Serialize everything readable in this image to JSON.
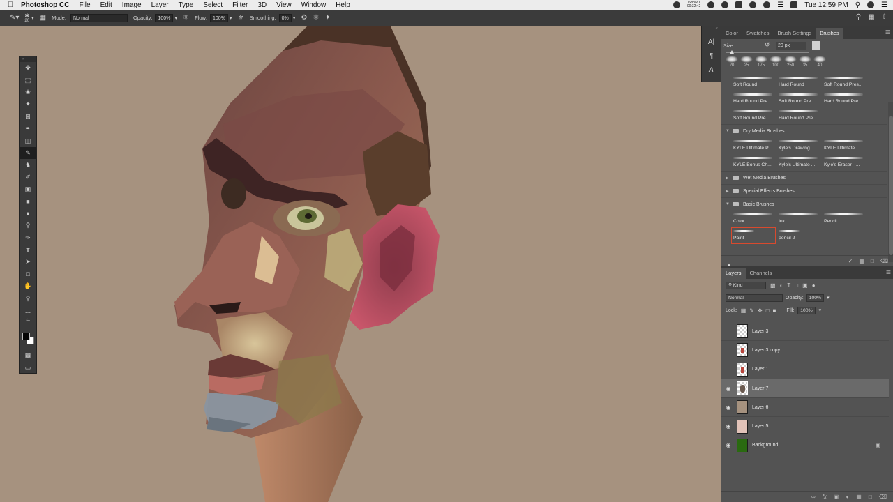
{
  "menubar": {
    "app_name": "Photoshop CC",
    "items": [
      "File",
      "Edit",
      "Image",
      "Layer",
      "Type",
      "Select",
      "Filter",
      "3D",
      "View",
      "Window",
      "Help"
    ],
    "ishowu_line1": "iShowU",
    "ishowu_line2": "00:32:42",
    "clock": "Tue 12:59 PM"
  },
  "options": {
    "brush_size": "20",
    "mode_label": "Mode:",
    "mode_value": "Normal",
    "opacity_label": "Opacity:",
    "opacity_value": "100%",
    "flow_label": "Flow:",
    "flow_value": "100%",
    "smoothing_label": "Smoothing:",
    "smoothing_value": "0%"
  },
  "brushes_panel": {
    "tabs": [
      "Color",
      "Swatches",
      "Brush Settings",
      "Brushes"
    ],
    "active_tab": "Brushes",
    "size_label": "Size:",
    "size_value": "20 px",
    "presets": [
      "20",
      "25",
      "175",
      "100",
      "250",
      "35",
      "40"
    ],
    "group_top": [
      "Soft Round",
      "Hard Round",
      "Soft Round Pres...",
      "Hard Round Pre...",
      "Soft Round Pre...",
      "Hard Round Pre...",
      "Soft Round Pre...",
      "Hard Round Pre..."
    ],
    "groups": [
      {
        "name": "Dry Media Brushes",
        "expanded": true,
        "items": [
          "KYLE Ultimate P...",
          "Kyle's Drawing ...",
          "KYLE Ultimate ...",
          "KYLE Bonus Ch...",
          "Kyle's Ultimate ...",
          "Kyle's Eraser - ..."
        ]
      },
      {
        "name": "Wet Media Brushes",
        "expanded": false,
        "items": []
      },
      {
        "name": "Special Effects Brushes",
        "expanded": false,
        "items": []
      },
      {
        "name": "Basic Brushes",
        "expanded": true,
        "items": [
          "Color",
          "Ink",
          "Pencil",
          "Paint",
          "pencil 2"
        ]
      }
    ],
    "selected_brush": "Paint"
  },
  "layers_panel": {
    "tabs": [
      "Layers",
      "Channels"
    ],
    "active_tab": "Layers",
    "filter_value": "Kind",
    "blend_value": "Normal",
    "opacity_label": "Opacity:",
    "opacity_value": "100%",
    "lock_label": "Lock:",
    "fill_label": "Fill:",
    "fill_value": "100%",
    "layers": [
      {
        "name": "Layer 3",
        "visible": false,
        "selected": false,
        "thumb": "check"
      },
      {
        "name": "Layer 3 copy",
        "visible": false,
        "selected": false,
        "thumb": "check-red"
      },
      {
        "name": "Layer 1",
        "visible": false,
        "selected": false,
        "thumb": "check-red"
      },
      {
        "name": "Layer 7",
        "visible": true,
        "selected": true,
        "thumb": "check-sketch"
      },
      {
        "name": "Layer 6",
        "visible": true,
        "selected": false,
        "thumb": "#a6927f"
      },
      {
        "name": "Layer 5",
        "visible": true,
        "selected": false,
        "thumb": "#e2c3b9"
      },
      {
        "name": "Background",
        "visible": true,
        "selected": false,
        "thumb": "#2a6a10",
        "locked": true
      }
    ]
  },
  "colors": {
    "canvas_bg": "#a6927f",
    "foreground": "#050505",
    "background": "#ffffff",
    "selection_outline": "#d84a2e"
  }
}
